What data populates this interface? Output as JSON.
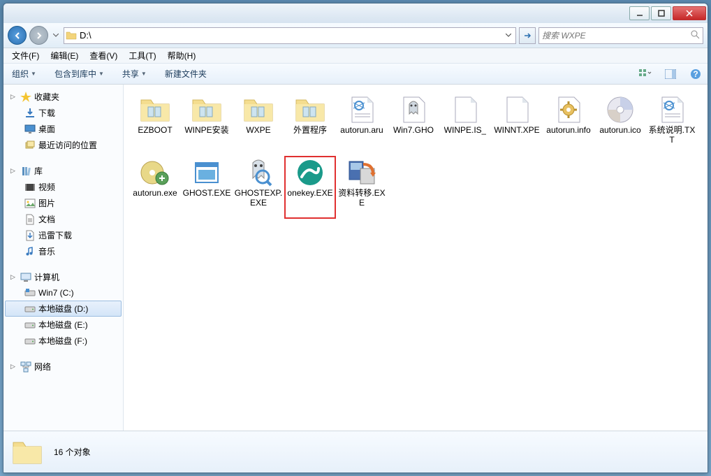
{
  "titlebar": {},
  "nav": {
    "path": "D:\\"
  },
  "search": {
    "placeholder": "搜索 WXPE"
  },
  "menu": {
    "items": [
      {
        "label": "文件(F)"
      },
      {
        "label": "编辑(E)"
      },
      {
        "label": "查看(V)"
      },
      {
        "label": "工具(T)"
      },
      {
        "label": "帮助(H)"
      }
    ]
  },
  "toolbar": {
    "items": [
      {
        "label": "组织",
        "dropdown": true
      },
      {
        "label": "包含到库中",
        "dropdown": true
      },
      {
        "label": "共享",
        "dropdown": true
      },
      {
        "label": "新建文件夹",
        "dropdown": false
      }
    ]
  },
  "sidebar": {
    "favorites": {
      "header": "收藏夹",
      "items": [
        {
          "label": "下载",
          "icon": "download"
        },
        {
          "label": "桌面",
          "icon": "desktop"
        },
        {
          "label": "最近访问的位置",
          "icon": "recent"
        }
      ]
    },
    "libraries": {
      "header": "库",
      "items": [
        {
          "label": "视频",
          "icon": "video"
        },
        {
          "label": "图片",
          "icon": "picture"
        },
        {
          "label": "文档",
          "icon": "doc"
        },
        {
          "label": "迅雷下载",
          "icon": "xunlei"
        },
        {
          "label": "音乐",
          "icon": "music"
        }
      ]
    },
    "computer": {
      "header": "计算机",
      "items": [
        {
          "label": "Win7 (C:)",
          "icon": "drive-win"
        },
        {
          "label": "本地磁盘 (D:)",
          "icon": "drive",
          "selected": true
        },
        {
          "label": "本地磁盘 (E:)",
          "icon": "drive"
        },
        {
          "label": "本地磁盘 (F:)",
          "icon": "drive"
        }
      ]
    },
    "network": {
      "header": "网络"
    }
  },
  "files": [
    {
      "name": "EZBOOT",
      "type": "folder"
    },
    {
      "name": "WINPE安装",
      "type": "folder"
    },
    {
      "name": "WXPE",
      "type": "folder"
    },
    {
      "name": "外置程序",
      "type": "folder"
    },
    {
      "name": "autorun.aru",
      "type": "text"
    },
    {
      "name": "Win7.GHO",
      "type": "ghost"
    },
    {
      "name": "WINPE.IS_",
      "type": "blank"
    },
    {
      "name": "WINNT.XPE",
      "type": "blank"
    },
    {
      "name": "autorun.info",
      "type": "gear"
    },
    {
      "name": "autorun.ico",
      "type": "disc"
    },
    {
      "name": "系统说明.TXT",
      "type": "text"
    },
    {
      "name": "autorun.exe",
      "type": "exe-disc"
    },
    {
      "name": "GHOST.EXE",
      "type": "exe-ghost"
    },
    {
      "name": "GHOSTEXP.EXE",
      "type": "exe-ghostexplorer"
    },
    {
      "name": "onekey.EXE",
      "type": "exe-onekey",
      "highlighted": true
    },
    {
      "name": "资料转移.EXE",
      "type": "exe-transfer"
    }
  ],
  "status": {
    "text": "16 个对象"
  }
}
